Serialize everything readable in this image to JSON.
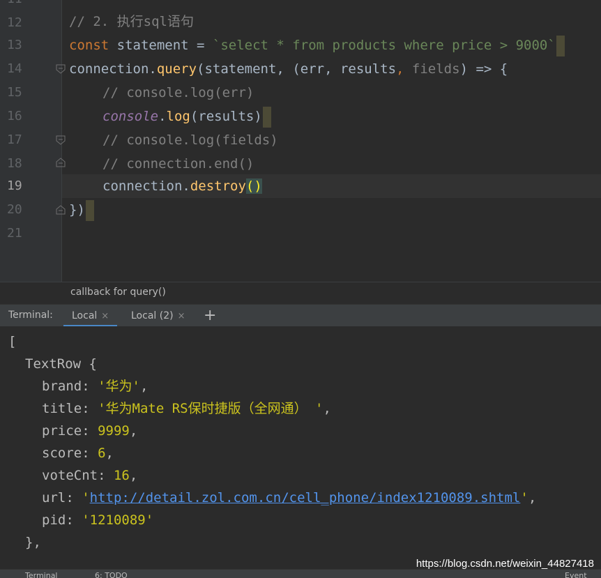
{
  "editor": {
    "line_numbers": [
      "11",
      "12",
      "13",
      "14",
      "15",
      "16",
      "17",
      "18",
      "19",
      "20",
      "21"
    ],
    "current_line": "19",
    "lines": {
      "l12": "// 2. 执行sql语句",
      "l13_kw": "const",
      "l13_var": " statement = ",
      "l13_str": "`select * from products where price > 9000`",
      "l14_a": "connection.",
      "l14_fn": "query",
      "l14_b": "(statement, (err",
      "l14_c": ", results",
      "l14_d": ", ",
      "l14_e": "fields",
      "l14_f": ") => {",
      "l15": "// console.log(err)",
      "l16_obj": "console",
      "l16_dot": ".",
      "l16_fn": "log",
      "l16_args": "(results)",
      "l17": "// console.log(fields)",
      "l18": "// connection.end()",
      "l19_a": "connection.",
      "l19_fn": "destroy",
      "l19_paren": "()",
      "l20": "})"
    }
  },
  "breadcrumb": "callback for query()",
  "terminal": {
    "label": "Terminal:",
    "tabs": [
      {
        "label": "Local",
        "close": "×"
      },
      {
        "label": "Local (2)",
        "close": "×"
      }
    ],
    "new_tab": "+",
    "output": {
      "open_bracket": "[",
      "row_type": "TextRow {",
      "brand_key": "brand: ",
      "brand_val": "'华为'",
      "title_key": "title: ",
      "title_val": "'华为Mate RS保时捷版（全网通） '",
      "price_key": "price: ",
      "price_val": "9999",
      "score_key": "score: ",
      "score_val": "6",
      "votecnt_key": "voteCnt: ",
      "votecnt_val": "16",
      "url_key": "url: ",
      "url_val": "http://detail.zol.com.cn/cell_phone/index1210089.shtml",
      "pid_key": "pid: ",
      "pid_val": "'1210089'",
      "close_row": "},"
    }
  },
  "statusbar": {
    "left1": "Terminal",
    "left2": "6: TODO",
    "right": "Event Log"
  },
  "watermark": "https://blog.csdn.net/weixin_44827418"
}
